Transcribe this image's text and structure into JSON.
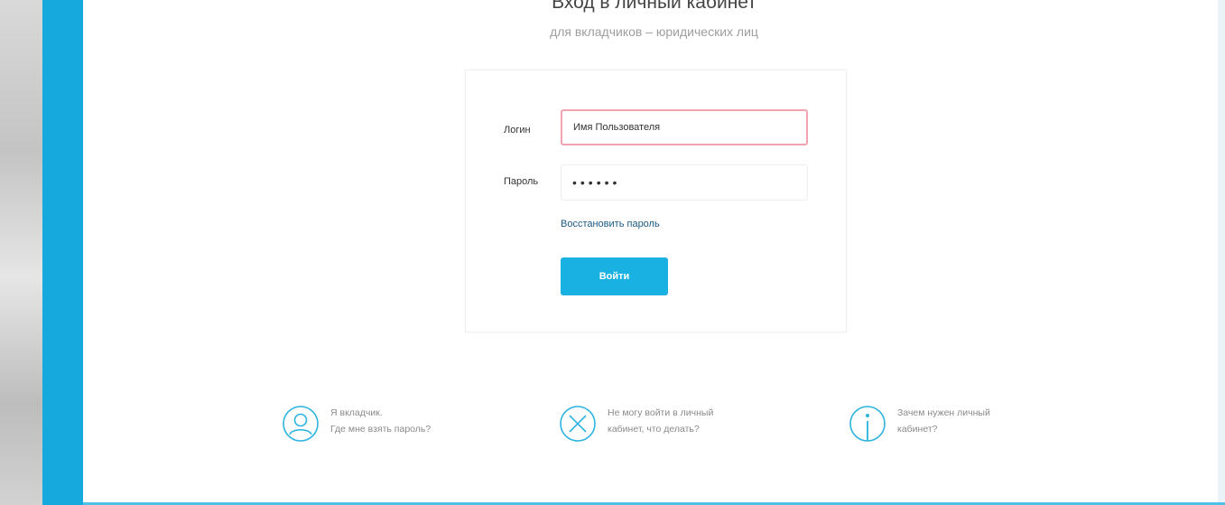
{
  "page": {
    "title": "Вход в личный кабинет",
    "subtitle": "для вкладчиков – юридических лиц"
  },
  "login_form": {
    "login_label": "Логин",
    "login_value": "Имя Пользователя",
    "password_label": "Пароль",
    "password_value": "••••••",
    "restore_link": "Восстановить пароль",
    "submit_label": "Войти"
  },
  "help_links": [
    {
      "icon": "user-icon",
      "line1": "Я вкладчик.",
      "line2": "Где мне взять пароль?"
    },
    {
      "icon": "cross-icon",
      "line1": "Не могу войти в личный",
      "line2": "кабинет, что делать?"
    },
    {
      "icon": "info-icon",
      "line1": "Зачем нужен личный",
      "line2": "кабинет?"
    }
  ],
  "colors": {
    "accent": "#16a9de",
    "button": "#19b1e1",
    "input_error_border": "#f1a3b0",
    "link": "#1a5a87"
  }
}
